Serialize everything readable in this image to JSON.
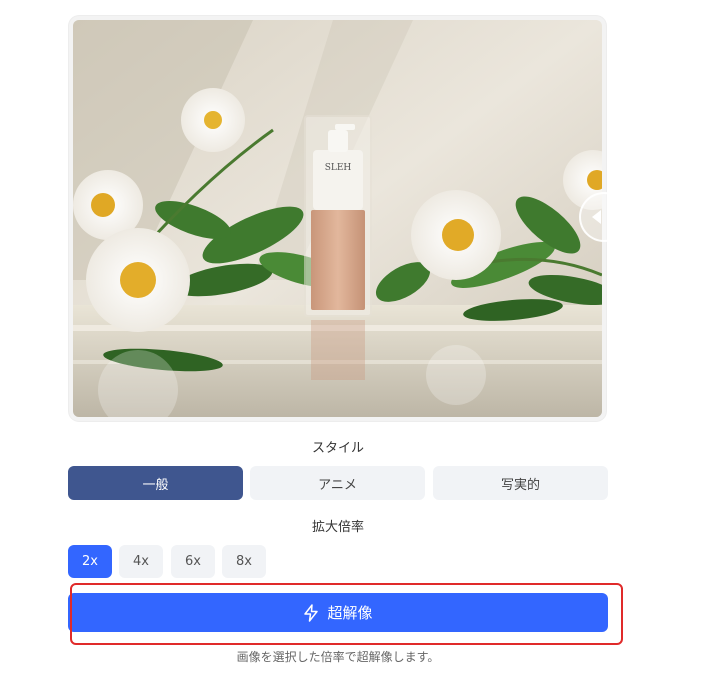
{
  "style_section": {
    "label": "スタイル",
    "options": [
      {
        "label": "一般",
        "selected": true
      },
      {
        "label": "アニメ",
        "selected": false
      },
      {
        "label": "写実的",
        "selected": false
      }
    ]
  },
  "scale_section": {
    "label": "拡大倍率",
    "options": [
      {
        "label": "2x",
        "selected": true
      },
      {
        "label": "4x",
        "selected": false
      },
      {
        "label": "6x",
        "selected": false
      },
      {
        "label": "8x",
        "selected": false
      }
    ]
  },
  "action": {
    "label": "超解像",
    "icon": "lightning-icon"
  },
  "hint": "画像を選択した倍率で超解像します。",
  "preview": {
    "bottle_label": "SLEH"
  },
  "colors": {
    "primary": "#3366ff",
    "style_selected": "#3f568f",
    "option_bg": "#f1f3f6",
    "highlight": "#e02a2a"
  }
}
